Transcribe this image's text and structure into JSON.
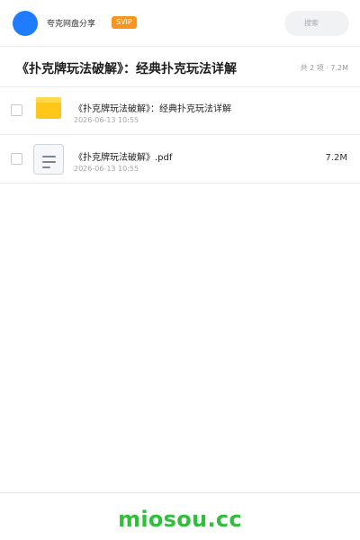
{
  "header": {
    "app_name": "夸克网盘分享",
    "badge": "SVIP",
    "search_placeholder": "搜索"
  },
  "share": {
    "title": "《扑克牌玩法破解》：经典扑克玩法详解",
    "summary": "共 2 项 · 7.2M"
  },
  "files": [
    {
      "icon": "folder-icon",
      "name": "《扑克牌玩法破解》：经典扑克玩法详解",
      "date": "2026-06-13 10:55",
      "size": ""
    },
    {
      "icon": "document-icon",
      "name": "《扑克牌玩法破解》.pdf",
      "date": "2026-06-13 10:55",
      "size": "7.2M"
    }
  ],
  "watermark": "miosou.cc",
  "colors": {
    "brand_blue": "#1f7cff",
    "svip_orange": "#f7961d",
    "folder_yellow": "#ffc719",
    "watermark_green": "#2fbf3a"
  }
}
